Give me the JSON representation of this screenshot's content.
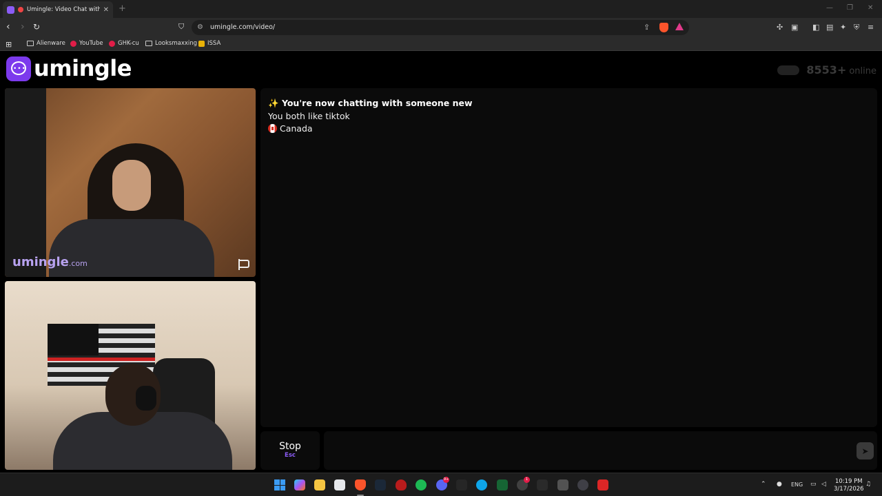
{
  "browser": {
    "tab_title": "Umingle: Video Chat with Str",
    "tab_close": "✕",
    "new_tab": "+",
    "window_controls": {
      "minimize": "—",
      "maximize": "❐",
      "close": "✕"
    },
    "url": "umingle.com/video/",
    "bookmarks": [
      "Alienware",
      "YouTube",
      "GHK-cu",
      "Looksmaxxing",
      "ISSA"
    ]
  },
  "site": {
    "logo_text": "umingle",
    "online_count": "8553+",
    "online_label": "online",
    "watermark": "umingle",
    "watermark_suffix": ".com"
  },
  "chat": {
    "headline_emoji": "✨",
    "headline": "You're now chatting with someone new",
    "common_interest": "You both like tiktok",
    "country": "Canada"
  },
  "controls": {
    "stop_label": "Stop",
    "stop_key": "Esc",
    "send_icon": "➤"
  },
  "taskbar": {
    "discord_badge": "9+",
    "whatsapp_badge": "1",
    "language": "ENG",
    "time": "10:19 PM",
    "date": "3/17/2026"
  },
  "colors": {
    "brand": "#7c3aed",
    "chat_bg": "#0b0b0b",
    "watermark": "#b8a2f0"
  }
}
